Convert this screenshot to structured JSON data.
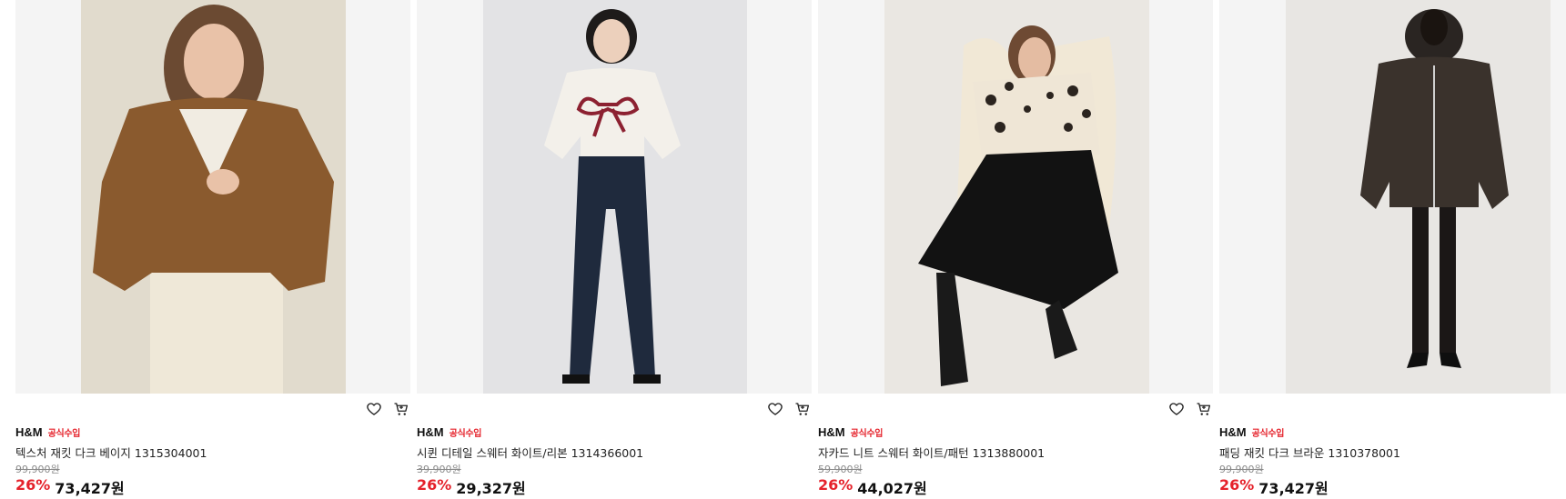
{
  "colors": {
    "accent_red": "#e5222b",
    "original_price_gray": "#8a8a8a"
  },
  "products": [
    {
      "image_name": "model-brown-jacket-image",
      "brand": "H&M",
      "badge": "공식수입",
      "name": "텍스처 재킷 다크 베이지 1315304001",
      "original_price": "99,900원",
      "discount": "26%",
      "price": "73,427원",
      "wishlist_icon": "heart-icon",
      "cart_icon": "cart-icon"
    },
    {
      "image_name": "model-bow-sweater-image",
      "brand": "H&M",
      "badge": "공식수입",
      "name": "시퀸 디테일 스웨터 화이트/리본 1314366001",
      "original_price": "39,900원",
      "discount": "26%",
      "price": "29,327원",
      "wishlist_icon": "heart-icon",
      "cart_icon": "cart-icon"
    },
    {
      "image_name": "model-jacquard-sweater-image",
      "brand": "H&M",
      "badge": "공식수입",
      "name": "자카드 니트 스웨터 화이트/패턴 1313880001",
      "original_price": "59,900원",
      "discount": "26%",
      "price": "44,027원",
      "wishlist_icon": "heart-icon",
      "cart_icon": "cart-icon"
    },
    {
      "image_name": "model-padded-jacket-image",
      "brand": "H&M",
      "badge": "공식수입",
      "name": "패딩 재킷 다크 브라운 1310378001",
      "original_price": "99,900원",
      "discount": "26%",
      "price": "73,427원",
      "wishlist_icon": "heart-icon",
      "cart_icon": "cart-icon"
    }
  ]
}
